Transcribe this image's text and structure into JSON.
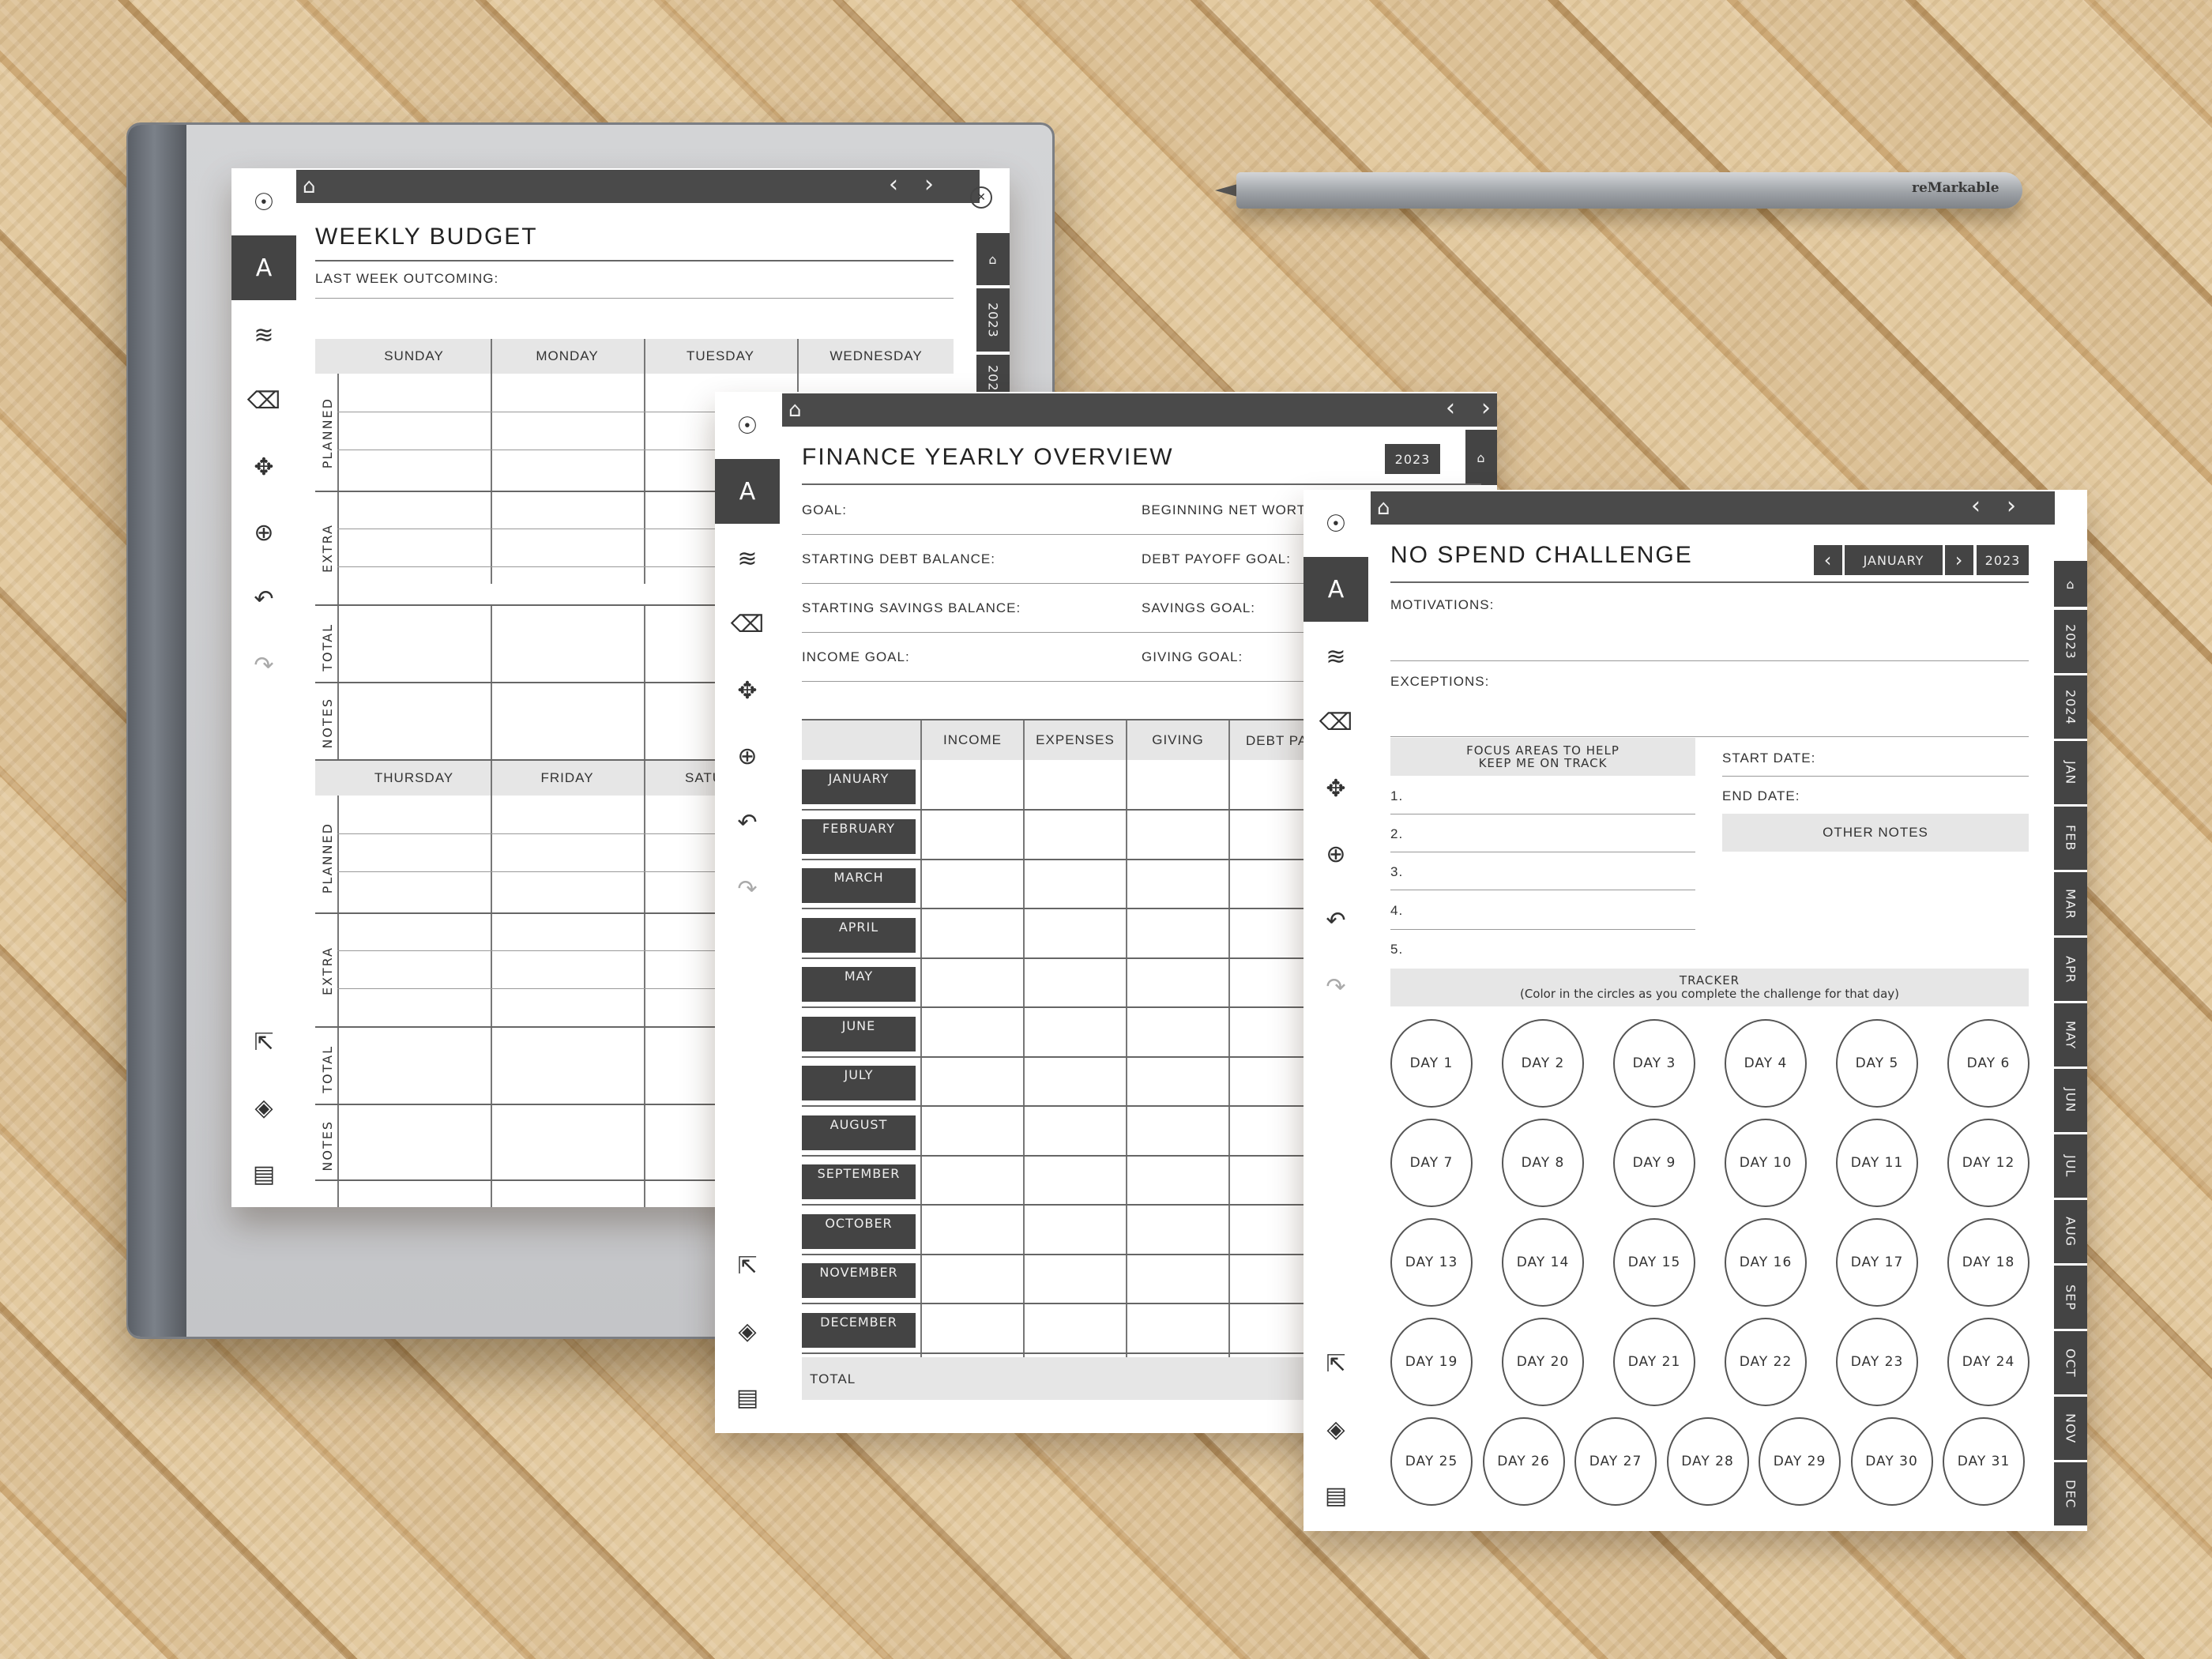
{
  "icons": {
    "home": "⌂",
    "prev": "‹",
    "next": "›",
    "close": "✕",
    "menu": "☉",
    "pen": "A",
    "tools": "≋",
    "eraser": "⌫",
    "move": "✥",
    "zoom": "⊕",
    "undo": "↶",
    "redo": "↷",
    "share": "⇱",
    "layers": "◈",
    "notebook": "▤"
  },
  "pen": {
    "brand": "reMarkable"
  },
  "weekly_budget": {
    "title": "WEEKLY BUDGET",
    "last_week_label": "LAST WEEK OUTCOMING:",
    "days_top": [
      "SUNDAY",
      "MONDAY",
      "TUESDAY",
      "WEDNESDAY"
    ],
    "days_bottom": [
      "THURSDAY",
      "FRIDAY",
      "SATU"
    ],
    "row_labels": [
      "PLANNED",
      "EXTRA",
      "TOTAL",
      "NOTES"
    ],
    "side_tabs": [
      "2023",
      "202"
    ]
  },
  "finance_overview": {
    "title": "FINANCE YEARLY OVERVIEW",
    "year_badge": "2023",
    "fields_left": [
      "GOAL:",
      "STARTING DEBT BALANCE:",
      "STARTING SAVINGS BALANCE:",
      "INCOME GOAL:"
    ],
    "fields_right": [
      "BEGINNING NET WORTH",
      "DEBT PAYOFF GOAL:",
      "SAVINGS GOAL:",
      "GIVING GOAL:"
    ],
    "columns": [
      "INCOME",
      "EXPENSES",
      "GIVING",
      "DEBT PA"
    ],
    "months": [
      "JANUARY",
      "FEBRUARY",
      "MARCH",
      "APRIL",
      "MAY",
      "JUNE",
      "JULY",
      "AUGUST",
      "SEPTEMBER",
      "OCTOBER",
      "NOVEMBER",
      "DECEMBER"
    ],
    "total_label": "TOTAL"
  },
  "no_spend": {
    "title": "NO SPEND CHALLENGE",
    "month": "JANUARY",
    "year": "2023",
    "motivations_label": "MOTIVATIONS:",
    "exceptions_label": "EXCEPTIONS:",
    "focus_header_1": "FOCUS AREAS TO HELP",
    "focus_header_2": "KEEP ME ON TRACK",
    "focus_items": [
      "1.",
      "2.",
      "3.",
      "4.",
      "5."
    ],
    "start_date_label": "START DATE:",
    "end_date_label": "END DATE:",
    "other_notes_label": "OTHER NOTES",
    "tracker_title": "TRACKER",
    "tracker_subtitle": "(Color in the circles as you complete the challenge for that day)",
    "days": [
      "DAY 1",
      "DAY 2",
      "DAY 3",
      "DAY 4",
      "DAY 5",
      "DAY 6",
      "DAY 7",
      "DAY 8",
      "DAY 9",
      "DAY 10",
      "DAY 11",
      "DAY 12",
      "DAY 13",
      "DAY 14",
      "DAY 15",
      "DAY 16",
      "DAY 17",
      "DAY 18",
      "DAY 19",
      "DAY 20",
      "DAY 21",
      "DAY 22",
      "DAY 23",
      "DAY 24",
      "DAY 25",
      "DAY 26",
      "DAY 27",
      "DAY 28",
      "DAY 29",
      "DAY 30",
      "DAY 31"
    ],
    "side_tabs": [
      "2023",
      "2024",
      "JAN",
      "FEB",
      "MAR",
      "APR",
      "MAY",
      "JUN",
      "JUL",
      "AUG",
      "SEP",
      "OCT",
      "NOV",
      "DEC"
    ]
  }
}
